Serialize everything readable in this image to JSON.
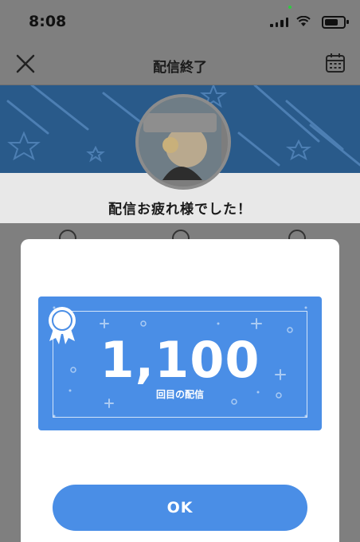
{
  "status_bar": {
    "time": "8:08"
  },
  "header": {
    "title": "配信終了"
  },
  "main": {
    "thanks_message": "配信お疲れ様でした！"
  },
  "modal": {
    "count": "1,100",
    "count_label": "回目の配信",
    "ok_label": "OK"
  },
  "colors": {
    "accent": "#4a8ee6",
    "banner": "#295a8a",
    "overlay": "#7f7f7f"
  },
  "icons": [
    "close-icon",
    "calendar-icon",
    "medal-icon",
    "signal-icon",
    "wifi-icon",
    "battery-icon"
  ]
}
